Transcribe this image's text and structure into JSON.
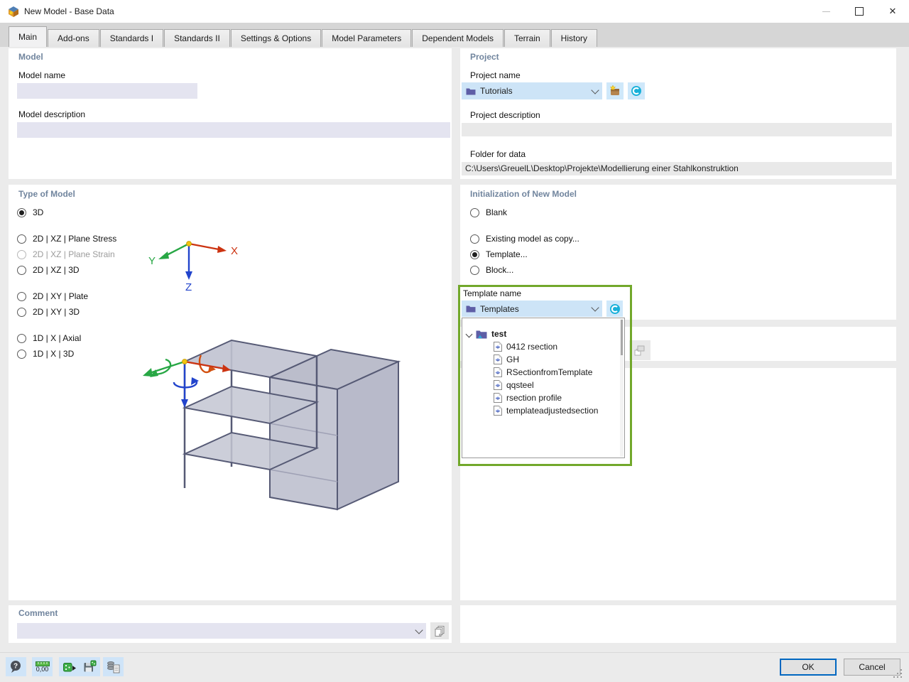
{
  "window": {
    "title": "New Model - Base Data"
  },
  "tabs": [
    {
      "label": "Main",
      "active": true
    },
    {
      "label": "Add-ons"
    },
    {
      "label": "Standards I"
    },
    {
      "label": "Standards II"
    },
    {
      "label": "Settings & Options"
    },
    {
      "label": "Model Parameters"
    },
    {
      "label": "Dependent Models"
    },
    {
      "label": "Terrain"
    },
    {
      "label": "History"
    }
  ],
  "model": {
    "heading": "Model",
    "name_label": "Model name",
    "name_value": "",
    "description_label": "Model description",
    "description_value": ""
  },
  "project": {
    "heading": "Project",
    "name_label": "Project name",
    "name_value": "Tutorials",
    "description_label": "Project description",
    "description_value": "",
    "folder_label": "Folder for data",
    "folder_value": "C:\\Users\\GreuelL\\Desktop\\Projekte\\Modellierung einer Stahlkonstruktion"
  },
  "type_of_model": {
    "heading": "Type of Model",
    "options": [
      {
        "label": "3D",
        "selected": true
      },
      {
        "label": "2D | XZ | Plane Stress"
      },
      {
        "label": "2D | XZ | Plane Strain",
        "disabled": true
      },
      {
        "label": "2D | XZ | 3D"
      },
      {
        "label": "2D | XY | Plate"
      },
      {
        "label": "2D | XY | 3D"
      },
      {
        "label": "1D | X | Axial"
      },
      {
        "label": "1D | X | 3D"
      }
    ],
    "axes": {
      "x": "X",
      "y": "Y",
      "z": "Z"
    }
  },
  "initialization": {
    "heading": "Initialization of New Model",
    "options": [
      {
        "label": "Blank"
      },
      {
        "label": "Existing model as copy..."
      },
      {
        "label": "Template...",
        "selected": true
      },
      {
        "label": "Block..."
      }
    ]
  },
  "template": {
    "label": "Template name",
    "combo_value": "Templates",
    "tree": {
      "root": "test",
      "items": [
        "0412 rsection",
        "GH",
        "RSectionfromTemplate",
        "qqsteel",
        "rsection profile",
        "templateadjustedsection"
      ]
    }
  },
  "comment": {
    "heading": "Comment",
    "value": ""
  },
  "footer": {
    "ok_label": "OK",
    "cancel_label": "Cancel",
    "toolbar": [
      {
        "name": "help"
      },
      {
        "name": "units-and-decimal-places",
        "text": "0,00"
      },
      {
        "name": "apply-settings-from-model"
      },
      {
        "name": "save-as-template"
      },
      {
        "name": "transfer-base-data"
      }
    ]
  },
  "colors": {
    "combo_blue": "#cde4f7",
    "input_lavender": "#e4e4f0",
    "heading_blue": "#71859e",
    "highlight_green": "#72a82b",
    "ok_focus_border": "#0067c0",
    "axis_x": "#cc3311",
    "axis_y": "#28a745",
    "axis_z": "#2244cc"
  }
}
